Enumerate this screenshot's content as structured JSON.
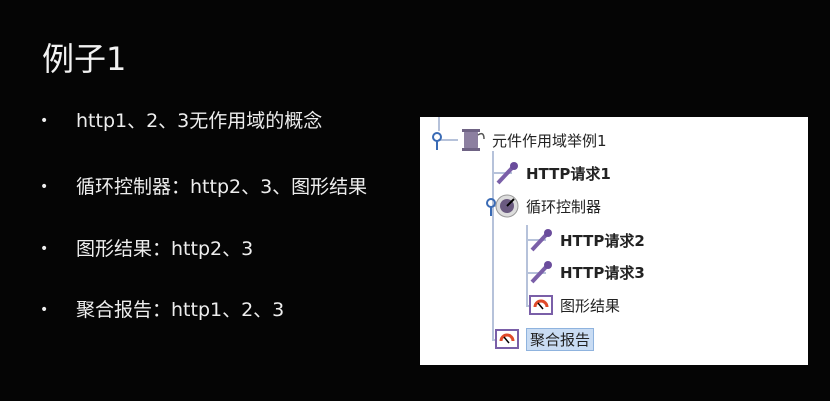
{
  "slide": {
    "title": "例子1",
    "bullets": [
      "http1、2、3无作用域的概念",
      "循环控制器：http2、3、图形结果",
      "图形结果：http2、3",
      "聚合报告：http1、2、3"
    ]
  },
  "tree": {
    "items": [
      {
        "label": "元件作用域举例1",
        "icon": "thread-group-icon"
      },
      {
        "label": "HTTP请求1",
        "icon": "sampler-pipette-icon"
      },
      {
        "label": "循环控制器",
        "icon": "loop-controller-icon"
      },
      {
        "label": "HTTP请求2",
        "icon": "sampler-pipette-icon"
      },
      {
        "label": "HTTP请求3",
        "icon": "sampler-pipette-icon"
      },
      {
        "label": "图形结果",
        "icon": "listener-gauge-icon"
      },
      {
        "label": "聚合报告",
        "icon": "listener-gauge-icon",
        "selected": true
      }
    ]
  },
  "colors": {
    "background": "#050505",
    "selection": "#c9dcf3",
    "icon": "#7a5fa8"
  }
}
